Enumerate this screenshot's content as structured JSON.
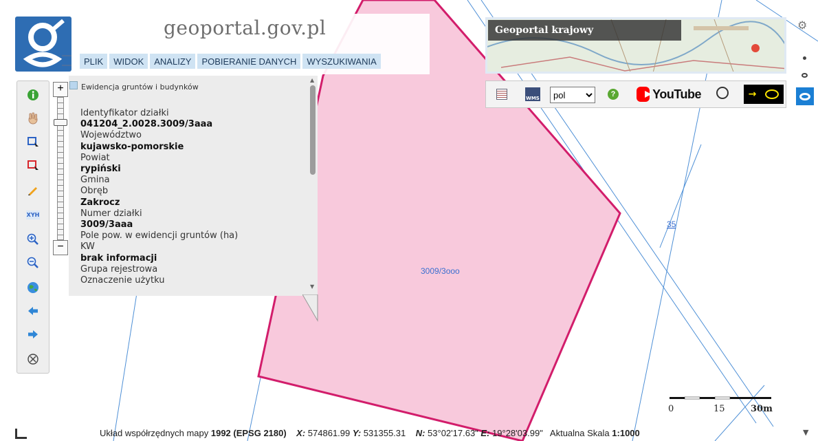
{
  "brand": {
    "title": "geoportal.gov.pl"
  },
  "menu": {
    "items": [
      "PLIK",
      "WIDOK",
      "ANALIZY",
      "POBIERANIE DANYCH",
      "WYSZUKIWANIA"
    ]
  },
  "map": {
    "parcel_label": "3009/3ooo",
    "side_label": "35",
    "polygon_fill": "#f8c9dc",
    "polygon_stroke": "#d21d6b",
    "line_color": "#4d8fd6"
  },
  "popup": {
    "layer_title": "Ewidencja gruntów i budynków",
    "fields": [
      {
        "label": "Identyfikator działki",
        "value": "041204_2.0028.3009/3aaa"
      },
      {
        "label": "Województwo",
        "value": "kujawsko-pomorskie"
      },
      {
        "label": "Powiat",
        "value": "rypiński"
      },
      {
        "label": "Gmina",
        "value": ""
      },
      {
        "label": "Obręb",
        "value": "Zakrocz"
      },
      {
        "label": "Numer działki",
        "value": "3009/3aaa"
      },
      {
        "label": "Pole pow. w ewidencji gruntów (ha)",
        "value": ""
      },
      {
        "label": "KW",
        "value": "brak informacji"
      },
      {
        "label": "Grupa rejestrowa",
        "value": ""
      },
      {
        "label": "Oznaczenie użytku",
        "value": ""
      }
    ]
  },
  "inset": {
    "title": "Geoportal krajowy"
  },
  "tools": {
    "language": "pol",
    "language_options": [
      "pol"
    ],
    "youtube_label": "YouTube"
  },
  "toolbar_icons": [
    "info-icon",
    "pan-hand-icon",
    "select-rectangle-icon",
    "select-rectangle-red-icon",
    "pencil-icon",
    "xyh-icon",
    "zoom-in-icon",
    "zoom-out-icon",
    "globe-icon",
    "back-arrow-icon",
    "forward-arrow-icon",
    "clear-icon"
  ],
  "status": {
    "prefix": "Układ współrzędnych mapy",
    "crs": "1992 (EPSG 2180)",
    "x_label": "X:",
    "x_value": "574861.99",
    "y_label": "Y:",
    "y_value": "531355.31",
    "n_label": "N:",
    "n_value": "53°02'17.63\"",
    "e_label": "E:",
    "e_value": "19°28'03.99\"",
    "scale_label": "Aktualna Skala",
    "scale_value": "1:1000"
  },
  "scale": {
    "ticks": [
      "0",
      "15",
      "30m"
    ]
  }
}
